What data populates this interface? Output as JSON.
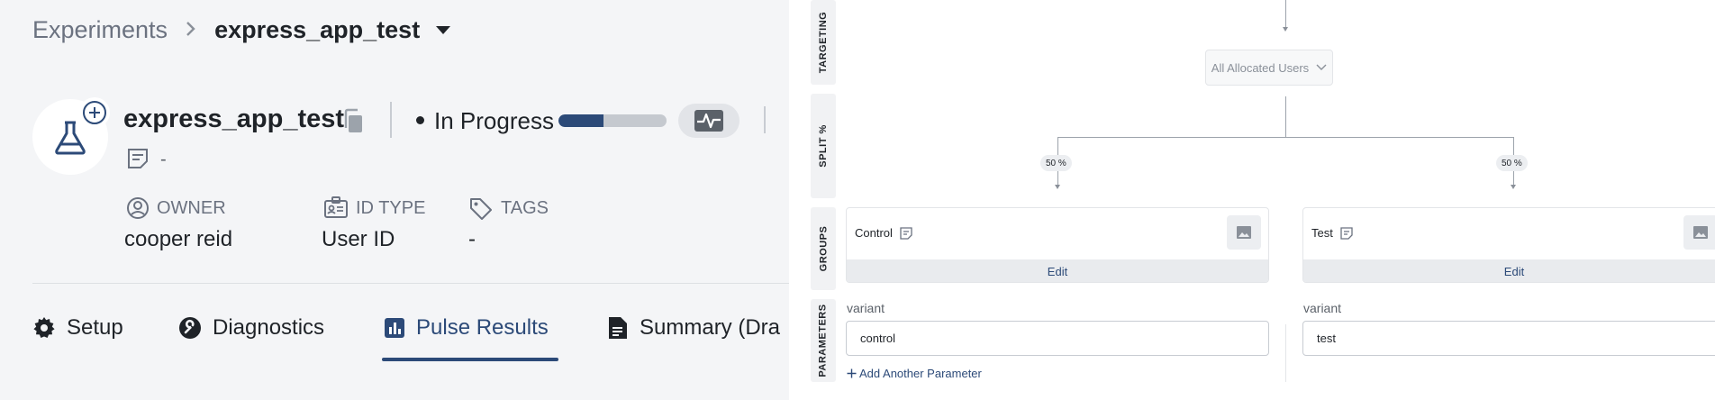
{
  "breadcrumb": {
    "root": "Experiments",
    "current": "express_app_test"
  },
  "experiment": {
    "title": "express_app_test",
    "status": "In Progress",
    "progress_fraction": 0.42,
    "description": "-"
  },
  "meta": {
    "owner": {
      "label": "OWNER",
      "value": "cooper reid"
    },
    "id_type": {
      "label": "ID TYPE",
      "value": "User ID"
    },
    "tags": {
      "label": "TAGS",
      "value": "-"
    }
  },
  "tabs": [
    {
      "label": "Setup",
      "icon": "gear-icon",
      "active": false
    },
    {
      "label": "Diagnostics",
      "icon": "wrench-icon",
      "active": false
    },
    {
      "label": "Pulse Results",
      "icon": "bar-chart-icon",
      "active": true
    },
    {
      "label": "Summary (Dra",
      "icon": "document-icon",
      "active": false
    }
  ],
  "flow": {
    "stages": [
      "TARGETING",
      "SPLIT %",
      "GROUPS",
      "PARAMETERS"
    ],
    "allocation_label": "All Allocated Users",
    "groups": [
      {
        "name": "Control",
        "split": "50 %",
        "edit_label": "Edit",
        "param_label": "variant",
        "param_value": "control"
      },
      {
        "name": "Test",
        "split": "50 %",
        "edit_label": "Edit",
        "param_label": "variant",
        "param_value": "test"
      }
    ],
    "add_parameter_label": "Add Another Parameter"
  },
  "colors": {
    "accent": "#2c4a78",
    "panel_bg": "#f4f5f7",
    "track": "#c5c9cf"
  }
}
